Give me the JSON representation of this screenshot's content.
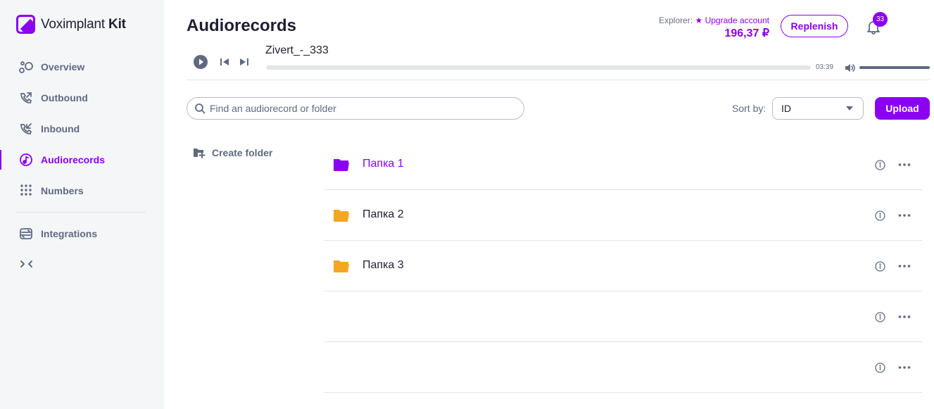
{
  "app": {
    "brand_name": "Voximplant",
    "brand_suffix": "Kit",
    "accent_color": "#8b00f0",
    "folder_color": "#f5a623"
  },
  "sidebar": {
    "items": [
      {
        "label": "Overview",
        "icon": "overview-icon"
      },
      {
        "label": "Outbound",
        "icon": "outbound-call-icon"
      },
      {
        "label": "Inbound",
        "icon": "inbound-call-icon"
      },
      {
        "label": "Audiorecords",
        "icon": "music-note-icon",
        "active": true
      },
      {
        "label": "Numbers",
        "icon": "dialpad-icon"
      },
      {
        "label": "Integrations",
        "icon": "sync-icon"
      }
    ],
    "collapse_icon": "collapse-icon"
  },
  "header": {
    "title": "Audiorecords",
    "plan_label": "Explorer:",
    "upgrade_label": "Upgrade account",
    "balance": "196,37 ₽",
    "replenish_label": "Replenish",
    "notifications_count": "33"
  },
  "player": {
    "track_name": "Zivert_-_333",
    "duration": "03:39",
    "progress": 0,
    "volume": 1.0
  },
  "toolbar": {
    "search_placeholder": "Find an audiorecord or folder",
    "sort_label": "Sort by:",
    "sort_value": "ID",
    "upload_label": "Upload"
  },
  "create_folder_label": "Create folder",
  "rows": [
    {
      "name": "Папка 1",
      "type": "folder",
      "active": true
    },
    {
      "name": "Папка 2",
      "type": "folder"
    },
    {
      "name": "Папка 3",
      "type": "folder"
    },
    {
      "name": "",
      "type": "record"
    },
    {
      "name": "",
      "type": "record"
    }
  ]
}
